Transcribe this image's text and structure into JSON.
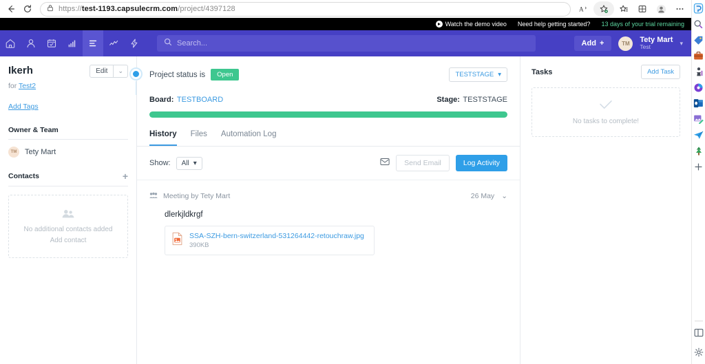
{
  "browser": {
    "back_icon": "back-arrow-icon",
    "reload_icon": "reload-icon",
    "lock_icon": "lock-icon",
    "url_prefix": "https://",
    "url_host": "test-1193.capsulecrm.com",
    "url_path": "/project/4397128",
    "read_aloud_icon": "read-aloud-icon",
    "add_favorite_icon": "add-favorite-icon",
    "favorites_icon": "favorites-icon",
    "collections_icon": "collections-icon",
    "profile_icon": "profile-icon",
    "settings_menu_icon": "ellipsis-icon"
  },
  "edge_sidebar": {
    "items": [
      {
        "name": "copilot-icon",
        "glyph": "◑",
        "color": "#1f7fd4"
      },
      {
        "name": "search-icon",
        "glyph": "🔍",
        "color": "#5a6570"
      },
      {
        "name": "shopping-tag-icon",
        "glyph": "🏷",
        "color": "#3b7fd4"
      },
      {
        "name": "tools-icon",
        "glyph": "🧰",
        "color": "#d4622a"
      },
      {
        "name": "games-icon",
        "glyph": "♟",
        "color": "#444a55"
      },
      {
        "name": "office-icon",
        "glyph": "◉",
        "color": "#7b3fd4"
      },
      {
        "name": "outlook-icon",
        "glyph": "✉",
        "color": "#1a6bbd"
      },
      {
        "name": "image-editor-icon",
        "glyph": "🖌",
        "color": "#7a4fd4"
      },
      {
        "name": "drop-icon",
        "glyph": "✈",
        "color": "#2f9fe8"
      },
      {
        "name": "tree-icon",
        "glyph": "🌲",
        "color": "#2f8f4e"
      },
      {
        "name": "add-sidebar-icon",
        "glyph": "+",
        "color": "#5a6570"
      }
    ],
    "bottom": [
      {
        "name": "split-screen-icon",
        "glyph": "▤",
        "color": "#5a6570"
      },
      {
        "name": "sidebar-settings-icon",
        "glyph": "⚙",
        "color": "#5a6570"
      }
    ]
  },
  "promo_bar": {
    "watch_demo": "Watch the demo video",
    "need_help": "Need help getting started?",
    "trial": "13 days of your trial remaining",
    "trial_color": "#5cd6a0"
  },
  "app_nav": {
    "icons": [
      {
        "name": "home-icon",
        "glyph": "⌂",
        "active": false
      },
      {
        "name": "people-icon",
        "glyph": "👤",
        "active": false
      },
      {
        "name": "calendar-icon",
        "glyph": "▤",
        "active": false
      },
      {
        "name": "bar-chart-icon",
        "glyph": "▮",
        "active": false
      },
      {
        "name": "projects-icon",
        "glyph": "≡",
        "active": true
      },
      {
        "name": "sales-trend-icon",
        "glyph": "〰",
        "active": false
      },
      {
        "name": "automation-icon",
        "glyph": "⚡",
        "active": false
      }
    ],
    "search_placeholder": "Search...",
    "search_icon": "search-icon",
    "add_label": "Add",
    "add_plus": "+",
    "avatar_initials": "TM",
    "user_name": "Tety Mart",
    "user_org": "Test",
    "brand_color": "#4640c4",
    "active_color": "#5a55d1"
  },
  "sidebar": {
    "project_title": "Ikerh",
    "edit_label": "Edit",
    "for_prefix": "for",
    "for_link": "Test2",
    "add_tags": "Add Tags",
    "owner_section": "Owner & Team",
    "owner_initials": "TM",
    "owner_name": "Tety Mart",
    "contacts_section": "Contacts",
    "contacts_empty_line1": "No additional contacts added",
    "contacts_empty_line2": "Add contact",
    "contacts_empty_icon": "people-group-icon"
  },
  "main": {
    "status_label": "Project status is",
    "status_badge": "Open",
    "status_badge_color": "#3ec78f",
    "stage_dropdown": "TESTSTAGE",
    "board_label": "Board:",
    "board_value": "TESTBOARD",
    "stage_label": "Stage:",
    "stage_value": "TESTSTAGE",
    "progress_percent": 100,
    "progress_color": "#3ec78f",
    "tabs": [
      {
        "label": "History",
        "active": true
      },
      {
        "label": "Files",
        "active": false
      },
      {
        "label": "Automation Log",
        "active": false
      }
    ],
    "show_label": "Show:",
    "show_value": "All",
    "email_icon": "envelope-icon",
    "send_email_label": "Send Email",
    "log_activity_label": "Log Activity",
    "activity": {
      "type_icon": "meeting-people-icon",
      "title": "Meeting by Tety Mart",
      "date": "26 May",
      "expand_icon": "chevron-down-icon",
      "body": "dlerkjldkrgf",
      "attachment": {
        "file_icon": "image-file-icon",
        "name": "SSA-SZH-bern-switzerland-531264442-retouchraw.jpg",
        "size": "390KB"
      }
    }
  },
  "tasks": {
    "title": "Tasks",
    "add_task_label": "Add Task",
    "empty_icon": "check-icon",
    "empty_text": "No tasks to complete!"
  }
}
